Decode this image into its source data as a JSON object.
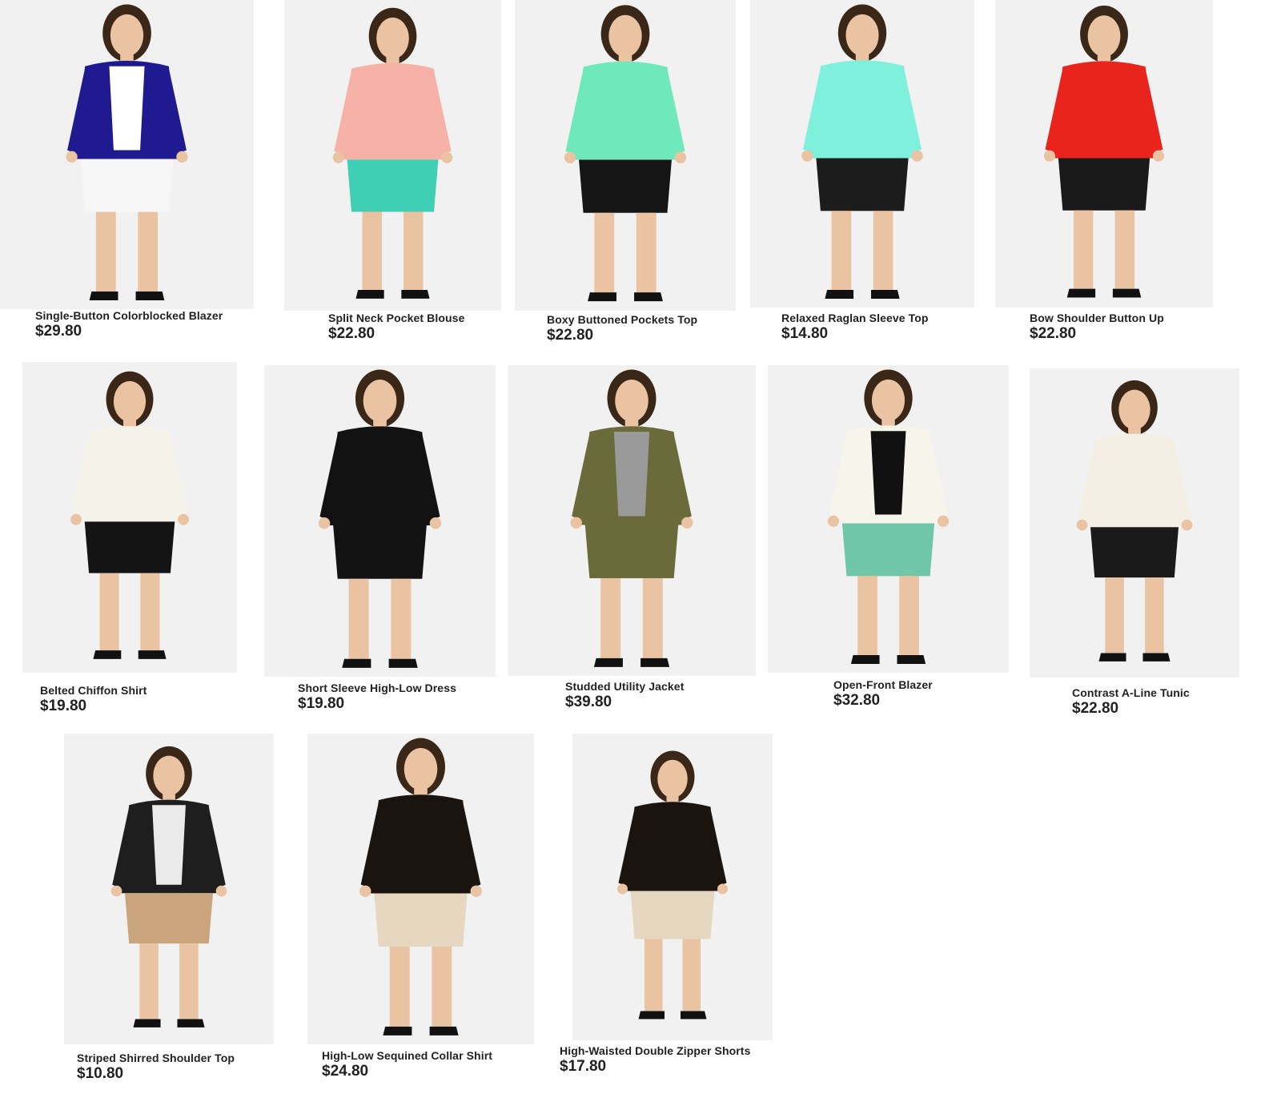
{
  "products": [
    {
      "name": "Single-Button Colorblocked Blazer",
      "price": "$29.80",
      "top_color": "#1f1a8f",
      "inner_color": "#ffffff",
      "bottom_color": "#f6f6f6",
      "icon": "blazer-shorts-outfit"
    },
    {
      "name": "Split Neck Pocket Blouse",
      "price": "$22.80",
      "top_color": "#f7b2a8",
      "inner_color": "#f7b2a8",
      "bottom_color": "#3fcfb4",
      "icon": "blouse-pants-outfit"
    },
    {
      "name": "Boxy Buttoned Pockets Top",
      "price": "$22.80",
      "top_color": "#6fe8bb",
      "inner_color": "#6fe8bb",
      "bottom_color": "#151515",
      "icon": "top-leggings-outfit"
    },
    {
      "name": "Relaxed Raglan Sleeve Top",
      "price": "$14.80",
      "top_color": "#7ff0dc",
      "inner_color": "#7ff0dc",
      "bottom_color": "#1c1c1c",
      "icon": "raglan-top-outfit"
    },
    {
      "name": "Bow Shoulder Button Up",
      "price": "$22.80",
      "top_color": "#e8241c",
      "inner_color": "#e8241c",
      "bottom_color": "#1a1a1a",
      "icon": "button-up-skirt-outfit"
    },
    {
      "name": "Belted Chiffon Shirt",
      "price": "$19.80",
      "top_color": "#f5f2ea",
      "inner_color": "#f5f2ea",
      "bottom_color": "#141414",
      "icon": "chiffon-shirt-outfit"
    },
    {
      "name": "Short Sleeve High-Low Dress",
      "price": "$19.80",
      "top_color": "#121212",
      "inner_color": "#121212",
      "bottom_color": "#121212",
      "icon": "high-low-dress-outfit"
    },
    {
      "name": "Studded Utility Jacket",
      "price": "$39.80",
      "top_color": "#6b6a3a",
      "inner_color": "#9a9a9a",
      "bottom_color": "#6b6a3a",
      "icon": "utility-jacket-outfit"
    },
    {
      "name": "Open-Front Blazer",
      "price": "$32.80",
      "top_color": "#f7f4ec",
      "inner_color": "#111111",
      "bottom_color": "#6fc6a8",
      "icon": "open-blazer-outfit"
    },
    {
      "name": "Contrast A-Line Tunic",
      "price": "$22.80",
      "top_color": "#f4efe4",
      "inner_color": "#f4efe4",
      "bottom_color": "#1a1a1a",
      "icon": "tunic-leggings-outfit"
    },
    {
      "name": "Striped Shirred Shoulder Top",
      "price": "$10.80",
      "top_color": "#1e1e1e",
      "inner_color": "#eaeaea",
      "bottom_color": "#caa47c",
      "icon": "striped-top-skirt-outfit"
    },
    {
      "name": "High-Low Sequined Collar Shirt",
      "price": "$24.80",
      "top_color": "#1a1410",
      "inner_color": "#1a1410",
      "bottom_color": "#e6d8c0",
      "icon": "sequined-shirt-outfit"
    },
    {
      "name": "High-Waisted Double Zipper Shorts",
      "price": "$17.80",
      "top_color": "#1a1410",
      "inner_color": "#1a1410",
      "bottom_color": "#e6d8c0",
      "icon": "zipper-shorts-outfit"
    }
  ]
}
